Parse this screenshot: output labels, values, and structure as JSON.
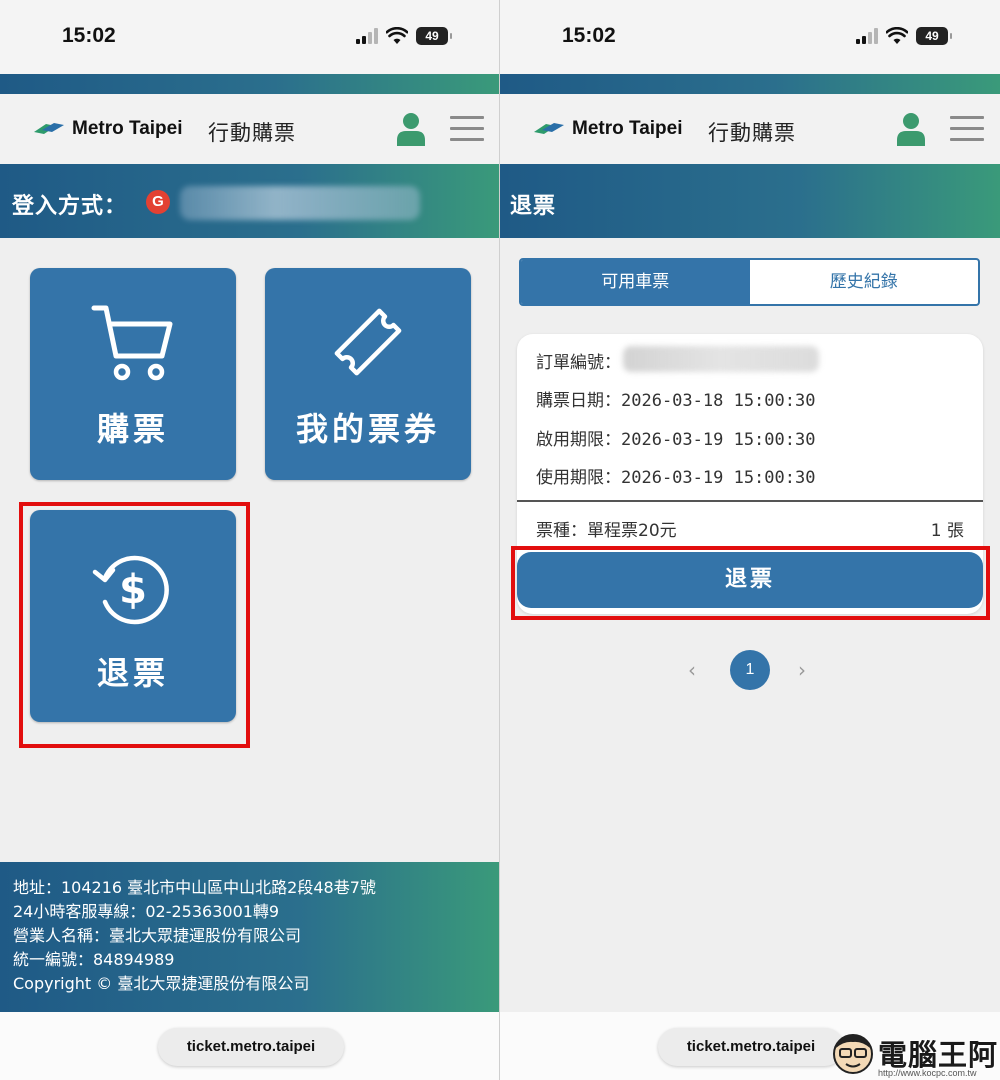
{
  "status_bar": {
    "time": "15:02",
    "battery": "49"
  },
  "header": {
    "brand": "Metro Taipei",
    "title": "行動購票"
  },
  "left": {
    "login_label": "登入方式：",
    "login_provider": "G",
    "tiles": [
      {
        "label": "購票",
        "icon": "cart-icon"
      },
      {
        "label": "我的票券",
        "icon": "ticket-icon"
      },
      {
        "label": "退票",
        "icon": "refund-dollar-icon"
      }
    ],
    "footer": {
      "address": "地址：104216 臺北市中山區中山北路2段48巷7號",
      "hotline": "24小時客服專線：02-25363001轉9",
      "company": "營業人名稱：臺北大眾捷運股份有限公司",
      "tax_id": "統一編號：84894989",
      "copyright": "Copyright © 臺北大眾捷運股份有限公司"
    }
  },
  "right": {
    "page_title": "退票",
    "tabs": [
      {
        "label": "可用車票",
        "active": true
      },
      {
        "label": "歷史紀錄",
        "active": false
      }
    ],
    "ticket": {
      "order_label": "訂單編號：",
      "purchase_label": "購票日期：",
      "purchase_value": "2026-03-18 15:00:30",
      "activate_label": "啟用期限：",
      "activate_value": "2026-03-19 15:00:30",
      "use_label": "使用期限：",
      "use_value": "2026-03-19 15:00:30",
      "type_label": "票種：單程票20元",
      "quantity": "1 張",
      "refund_button": "退票"
    },
    "pagination": {
      "prev": "‹",
      "current": "1",
      "next": "›"
    }
  },
  "address_bar": {
    "url": "ticket.metro.taipei"
  },
  "watermark": {
    "text": "電腦王阿達",
    "url": "http://www.kocpc.com.tw"
  },
  "colors": {
    "primary": "#3474a9",
    "highlight": "#e20e0e",
    "gradient_start": "#1f5a86",
    "gradient_end": "#3a9a7a",
    "avatar": "#3c9a6e"
  }
}
